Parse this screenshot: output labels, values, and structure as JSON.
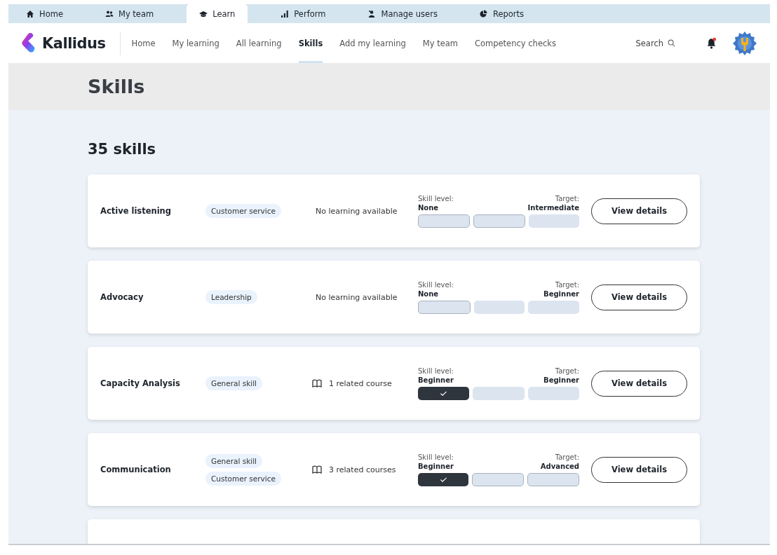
{
  "top_tabs": [
    {
      "label": "Home",
      "selected": false
    },
    {
      "label": "My team",
      "selected": false
    },
    {
      "label": "Learn",
      "selected": true
    },
    {
      "label": "Perform",
      "selected": false
    },
    {
      "label": "Manage users",
      "selected": false
    },
    {
      "label": "Reports",
      "selected": false
    }
  ],
  "brand": {
    "name": "Kallidus"
  },
  "nav": [
    {
      "label": "Home",
      "selected": false
    },
    {
      "label": "My learning",
      "selected": false
    },
    {
      "label": "All learning",
      "selected": false
    },
    {
      "label": "Skills",
      "selected": true
    },
    {
      "label": "Add my learning",
      "selected": false
    },
    {
      "label": "My team",
      "selected": false
    },
    {
      "label": "Competency checks",
      "selected": false
    }
  ],
  "search": {
    "label": "Search"
  },
  "notifications": {
    "unread": true
  },
  "page_title": "Skills",
  "count": "35 skills",
  "skills": [
    {
      "name": "Active listening",
      "tags": [
        "Customer service"
      ],
      "learning": {
        "kind": "none",
        "text": "No learning available"
      },
      "level_label": "Skill level:",
      "level": "None",
      "target_label": "Target:",
      "target": "Intermediate",
      "segments": [
        {
          "achieved": false,
          "target": true
        },
        {
          "achieved": false,
          "target": true
        },
        {
          "achieved": false,
          "target": false
        }
      ],
      "button": "View details"
    },
    {
      "name": "Advocacy",
      "tags": [
        "Leadership"
      ],
      "learning": {
        "kind": "none",
        "text": "No learning available"
      },
      "level_label": "Skill level:",
      "level": "None",
      "target_label": "Target:",
      "target": "Beginner",
      "segments": [
        {
          "achieved": false,
          "target": true
        },
        {
          "achieved": false,
          "target": false
        },
        {
          "achieved": false,
          "target": false
        }
      ],
      "button": "View details"
    },
    {
      "name": "Capacity Analysis",
      "tags": [
        "General skill"
      ],
      "learning": {
        "kind": "courses",
        "text": "1 related course"
      },
      "level_label": "Skill level:",
      "level": "Beginner",
      "target_label": "Target:",
      "target": "Beginner",
      "segments": [
        {
          "achieved": true,
          "target": false
        },
        {
          "achieved": false,
          "target": false
        },
        {
          "achieved": false,
          "target": false
        }
      ],
      "button": "View details"
    },
    {
      "name": "Communication",
      "tags": [
        "General skill",
        "Customer service"
      ],
      "learning": {
        "kind": "courses",
        "text": "3 related courses"
      },
      "level_label": "Skill level:",
      "level": "Beginner",
      "target_label": "Target:",
      "target": "Advanced",
      "segments": [
        {
          "achieved": true,
          "target": false
        },
        {
          "achieved": false,
          "target": true
        },
        {
          "achieved": false,
          "target": true
        }
      ],
      "button": "View details"
    }
  ]
}
